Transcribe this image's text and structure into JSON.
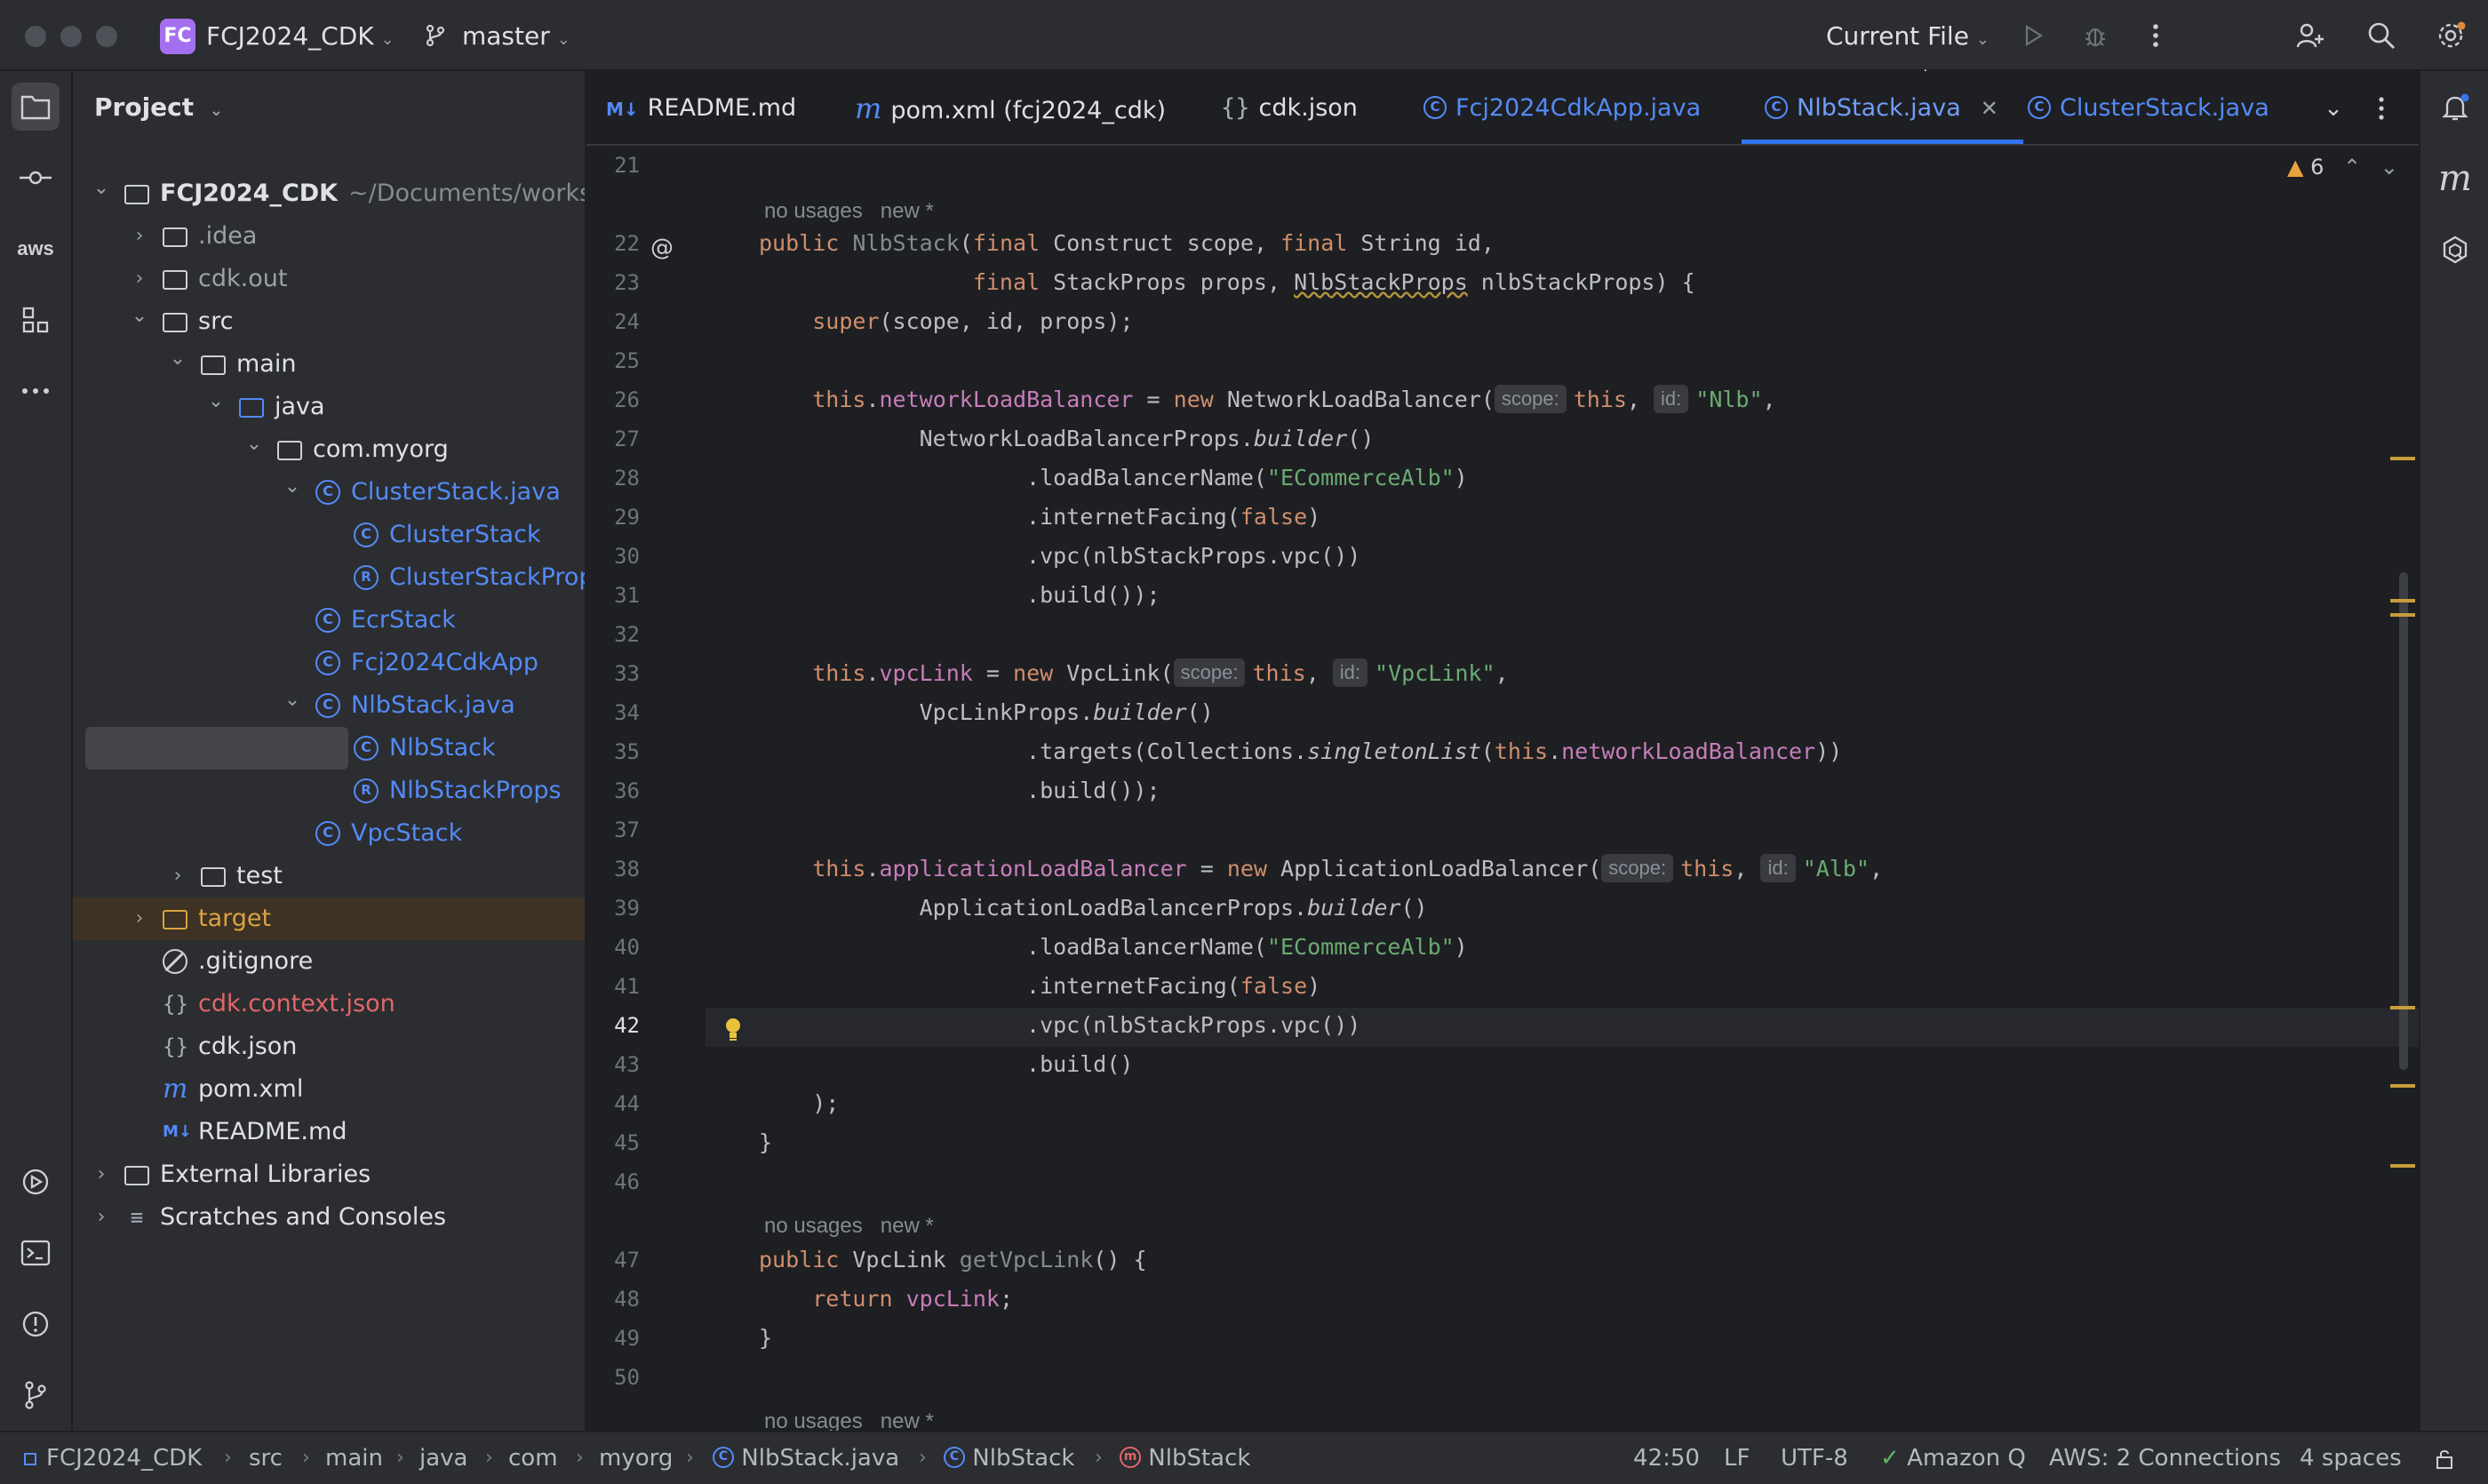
{
  "titlebar": {
    "project_badge": "FC",
    "project_name": "FCJ2024_CDK",
    "branch": "master",
    "run_config": "Current File"
  },
  "project_panel": {
    "title": "Project",
    "tree": [
      {
        "label": "FCJ2024_CDK",
        "suffix": "~/Documents/workshop",
        "depth": 0,
        "arrow": "down",
        "icon": "module-folder",
        "color": "#dfe1e5",
        "bold": true
      },
      {
        "label": ".idea",
        "depth": 1,
        "arrow": "right",
        "icon": "folder",
        "color": "#9da0a8"
      },
      {
        "label": "cdk.out",
        "depth": 1,
        "arrow": "right",
        "icon": "folder",
        "color": "#9da0a8"
      },
      {
        "label": "src",
        "depth": 1,
        "arrow": "down",
        "icon": "folder",
        "color": "#dfe1e5"
      },
      {
        "label": "main",
        "depth": 2,
        "arrow": "down",
        "icon": "folder",
        "color": "#dfe1e5"
      },
      {
        "label": "java",
        "depth": 3,
        "arrow": "down",
        "icon": "source-folder",
        "color": "#dfe1e5"
      },
      {
        "label": "com.myorg",
        "depth": 4,
        "arrow": "down",
        "icon": "package",
        "color": "#dfe1e5"
      },
      {
        "label": "ClusterStack.java",
        "depth": 5,
        "arrow": "down",
        "icon": "class",
        "color": "#548af7"
      },
      {
        "label": "ClusterStack",
        "depth": 6,
        "arrow": "",
        "icon": "class",
        "color": "#548af7"
      },
      {
        "label": "ClusterStackProps",
        "depth": 6,
        "arrow": "",
        "icon": "record",
        "color": "#548af7"
      },
      {
        "label": "EcrStack",
        "depth": 5,
        "arrow": "",
        "icon": "class",
        "color": "#548af7"
      },
      {
        "label": "Fcj2024CdkApp",
        "depth": 5,
        "arrow": "",
        "icon": "class",
        "color": "#548af7"
      },
      {
        "label": "NlbStack.java",
        "depth": 5,
        "arrow": "down",
        "icon": "class",
        "color": "#548af7"
      },
      {
        "label": "NlbStack",
        "depth": 6,
        "arrow": "",
        "icon": "class",
        "color": "#548af7",
        "selected": true
      },
      {
        "label": "NlbStackProps",
        "depth": 6,
        "arrow": "",
        "icon": "record",
        "color": "#548af7"
      },
      {
        "label": "VpcStack",
        "depth": 5,
        "arrow": "",
        "icon": "class",
        "color": "#548af7"
      },
      {
        "label": "test",
        "depth": 2,
        "arrow": "right",
        "icon": "folder",
        "color": "#dfe1e5"
      },
      {
        "label": "target",
        "depth": 1,
        "arrow": "right",
        "icon": "folder-orange",
        "color": "#d9a343",
        "highlight": true
      },
      {
        "label": ".gitignore",
        "depth": 1,
        "arrow": "",
        "icon": "ignore",
        "color": "#dfe1e5"
      },
      {
        "label": "cdk.context.json",
        "depth": 1,
        "arrow": "",
        "icon": "json",
        "color": "#e0676a"
      },
      {
        "label": "cdk.json",
        "depth": 1,
        "arrow": "",
        "icon": "json",
        "color": "#dfe1e5"
      },
      {
        "label": "pom.xml",
        "depth": 1,
        "arrow": "",
        "icon": "maven",
        "color": "#dfe1e5"
      },
      {
        "label": "README.md",
        "depth": 1,
        "arrow": "",
        "icon": "markdown",
        "color": "#dfe1e5"
      },
      {
        "label": "External Libraries",
        "depth": 0,
        "arrow": "right",
        "icon": "libraries",
        "color": "#dfe1e5"
      },
      {
        "label": "Scratches and Consoles",
        "depth": 0,
        "arrow": "right",
        "icon": "scratches",
        "color": "#dfe1e5"
      }
    ]
  },
  "tabs": [
    {
      "label": "README.md",
      "icon": "M↓",
      "active": false,
      "color": "#dfe1e5"
    },
    {
      "label": "pom.xml (fcj2024_cdk)",
      "icon": "m",
      "active": false,
      "color": "#dfe1e5"
    },
    {
      "label": "cdk.json",
      "icon": "{}",
      "active": false,
      "color": "#dfe1e5"
    },
    {
      "label": "Fcj2024CdkApp.java",
      "icon": "C",
      "active": false,
      "color": "#548af7"
    },
    {
      "label": "NlbStack.java",
      "icon": "C",
      "active": true,
      "color": "#6f9ef8"
    },
    {
      "label": "ClusterStack.java",
      "icon": "C",
      "active": false,
      "color": "#548af7"
    }
  ],
  "editor": {
    "warnings_count": "6",
    "inlay_no_usages": "no usages",
    "inlay_new": "new *",
    "lines": [
      {
        "n": "21",
        "html": ""
      },
      {
        "n": "22",
        "html": "<span class=\"kw\">public</span> <span class=\"dim\">NlbStack</span>(<span class=\"kw\">final</span> Construct scope, <span class=\"kw\">final</span> String id,"
      },
      {
        "n": "23",
        "html": "                <span class=\"kw\">final</span> StackProps props, <span style=\"text-decoration: underline wavy #b5953a;\">NlbStackProps</span> nlbStackProps) {"
      },
      {
        "n": "24",
        "html": "    <span class=\"kw\">super</span>(scope, id, props);"
      },
      {
        "n": "25",
        "html": ""
      },
      {
        "n": "26",
        "html": "    <span class=\"kw\">this</span>.<span class=\"fld\">networkLoadBalancer</span> = <span class=\"kw\">new</span> NetworkLoadBalancer(<span class=\"hint\">scope:</span><span class=\"kw\">this</span>, <span class=\"hint\">id:</span><span class=\"str\">\"Nlb\"</span>,"
      },
      {
        "n": "27",
        "html": "            NetworkLoadBalancerProps.<span class=\"ital\">builder</span>()"
      },
      {
        "n": "28",
        "html": "                    .loadBalancerName(<span class=\"str\">\"ECommerceAlb\"</span>)"
      },
      {
        "n": "29",
        "html": "                    .internetFacing(<span class=\"kw\">false</span>)"
      },
      {
        "n": "30",
        "html": "                    .vpc(nlbStackProps.vpc())"
      },
      {
        "n": "31",
        "html": "                    .build());"
      },
      {
        "n": "32",
        "html": ""
      },
      {
        "n": "33",
        "html": "    <span class=\"kw\">this</span>.<span class=\"fld\">vpcLink</span> = <span class=\"kw\">new</span> VpcLink(<span class=\"hint\">scope:</span><span class=\"kw\">this</span>, <span class=\"hint\">id:</span><span class=\"str\">\"VpcLink\"</span>,"
      },
      {
        "n": "34",
        "html": "            VpcLinkProps.<span class=\"ital\">builder</span>()"
      },
      {
        "n": "35",
        "html": "                    .targets(Collections.<span class=\"ital\">singletonList</span>(<span class=\"kw\">this</span>.<span class=\"fld\">networkLoadBalancer</span>))"
      },
      {
        "n": "36",
        "html": "                    .build());"
      },
      {
        "n": "37",
        "html": ""
      },
      {
        "n": "38",
        "html": "    <span class=\"kw\">this</span>.<span class=\"fld\">applicationLoadBalancer</span> = <span class=\"kw\">new</span> ApplicationLoadBalancer(<span class=\"hint\">scope:</span><span class=\"kw\">this</span>, <span class=\"hint\">id:</span><span class=\"str\">\"Alb\"</span>,"
      },
      {
        "n": "39",
        "html": "            ApplicationLoadBalancerProps.<span class=\"ital\">builder</span>()"
      },
      {
        "n": "40",
        "html": "                    .loadBalancerName(<span class=\"str\">\"ECommerceAlb\"</span>)"
      },
      {
        "n": "41",
        "html": "                    .internetFacing(<span class=\"kw\">false</span>)"
      },
      {
        "n": "42",
        "html": "                    .vpc(nlbStackProps.vpc())"
      },
      {
        "n": "43",
        "html": "                    .build()"
      },
      {
        "n": "44",
        "html": "    );"
      },
      {
        "n": "45",
        "html": "}"
      },
      {
        "n": "46",
        "html": ""
      },
      {
        "n": "47",
        "html": "<span class=\"kw\">public</span> VpcLink <span class=\"dim\">getVpcLink</span>() {"
      },
      {
        "n": "48",
        "html": "    <span class=\"kw\">return</span> <span class=\"fld\">vpcLink</span>;"
      },
      {
        "n": "49",
        "html": "}"
      },
      {
        "n": "50",
        "html": ""
      }
    ]
  },
  "statusbar": {
    "crumbs": [
      "FCJ2024_CDK",
      "src",
      "main",
      "java",
      "com",
      "myorg",
      "NlbStack.java",
      "NlbStack",
      "NlbStack"
    ],
    "position": "42:50",
    "line_sep": "LF",
    "encoding": "UTF-8",
    "amazon_q": "Amazon Q",
    "aws": "AWS: 2 Connections",
    "indent": "4 spaces"
  },
  "colors": {
    "accent": "#3574f0",
    "class_blue": "#548af7",
    "keyword": "#cf8e6d",
    "field": "#c77dbb",
    "string": "#6aab73",
    "badge_purple": "#a570ef"
  }
}
